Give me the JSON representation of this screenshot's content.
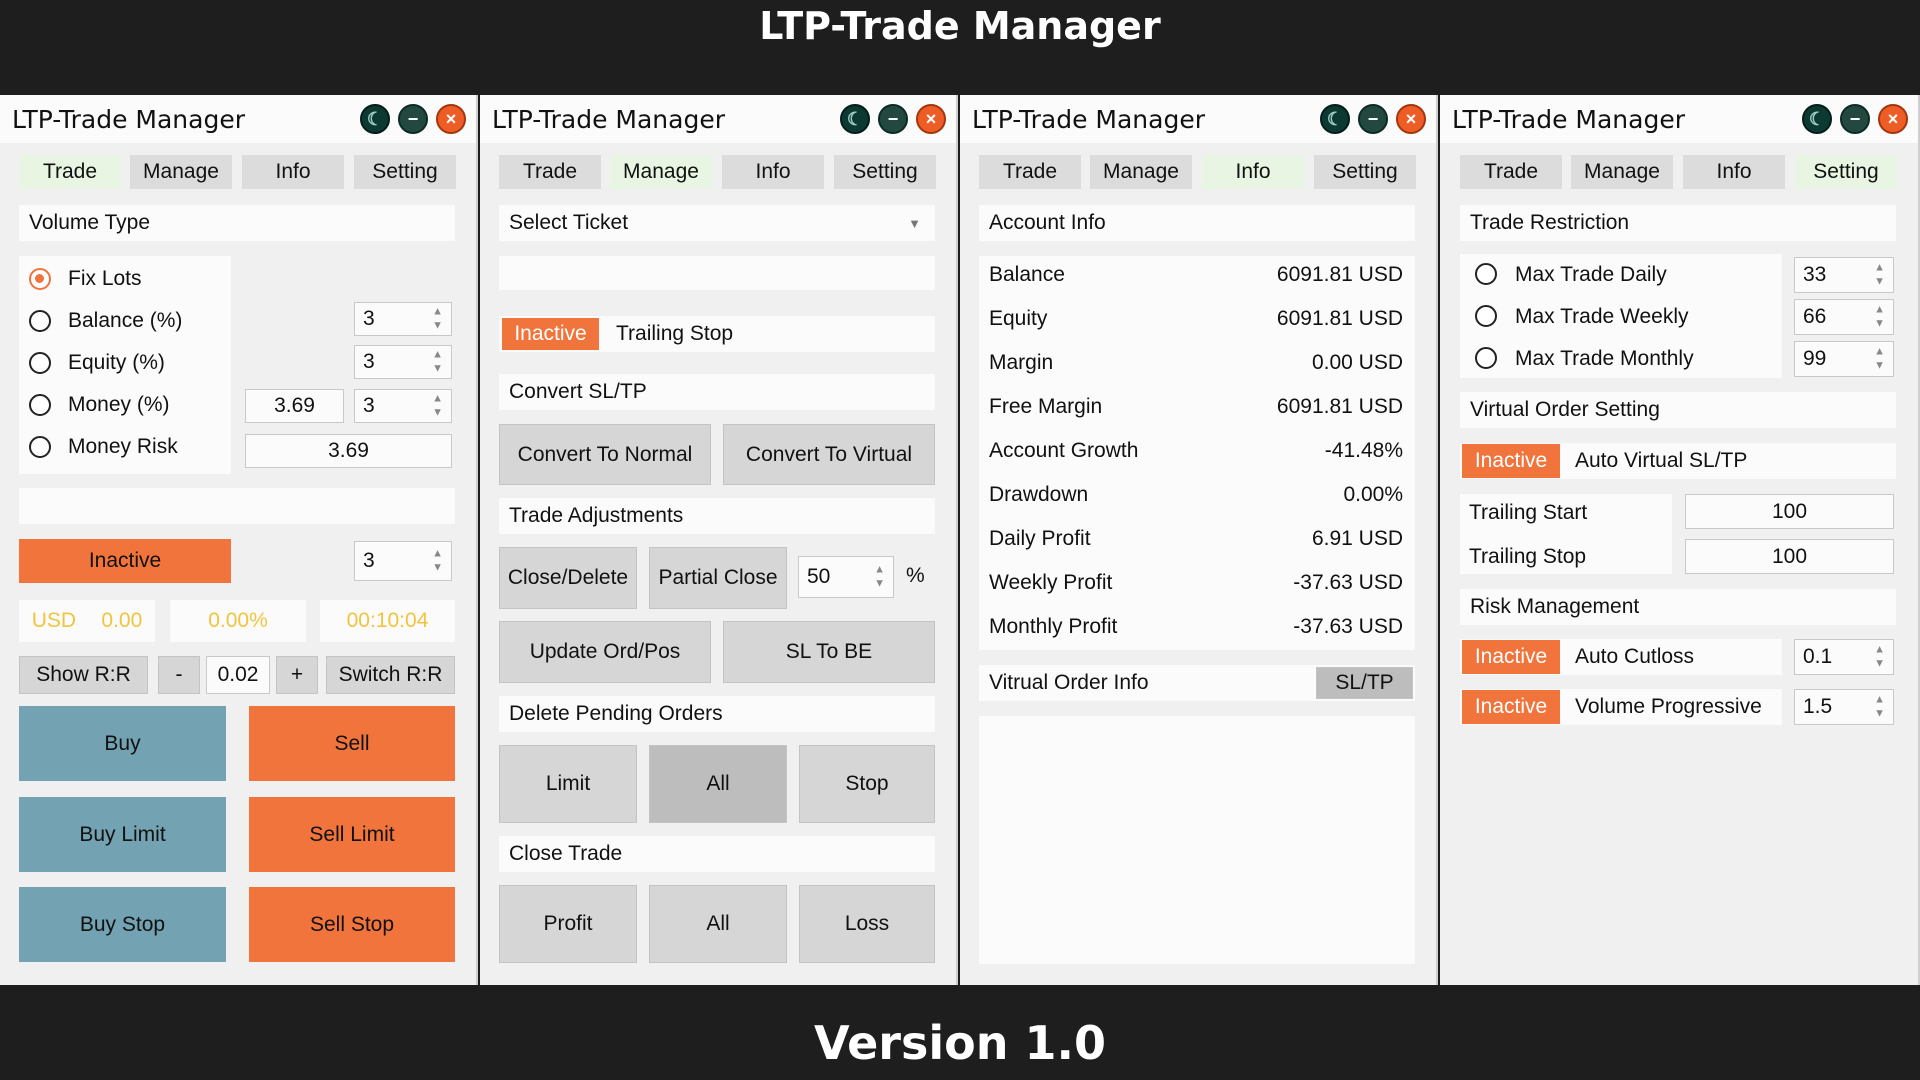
{
  "banner": {
    "title": "LTP-Trade Manager",
    "version": "Version 1.0"
  },
  "window_title": "LTP-Trade Manager",
  "tabs": [
    "Trade",
    "Manage",
    "Info",
    "Setting"
  ],
  "trade": {
    "volume_type_label": "Volume Type",
    "options": [
      "Fix Lots",
      "Balance (%)",
      "Equity (%)",
      "Money (%)",
      "Money Risk"
    ],
    "selected_option": "Fix Lots",
    "balance_pct": "3",
    "equity_pct": "3",
    "money_pct_amount": "3.69",
    "money_pct": "3",
    "money_risk": "3.69",
    "status_button": "Inactive",
    "status_value": "3",
    "currency": "USD",
    "pnl": "0.00",
    "pnl_pct": "0.00%",
    "timer": "00:10:04",
    "show_rr": "Show R:R",
    "minus": "-",
    "rr_step": "0.02",
    "plus": "+",
    "switch_rr": "Switch R:R",
    "buy": "Buy",
    "sell": "Sell",
    "buy_limit": "Buy Limit",
    "sell_limit": "Sell Limit",
    "buy_stop": "Buy Stop",
    "sell_stop": "Sell Stop"
  },
  "manage": {
    "select_ticket": "Select Ticket",
    "trailing_status": "Inactive",
    "trailing_label": "Trailing Stop",
    "convert_label": "Convert SL/TP",
    "convert_normal": "Convert To Normal",
    "convert_virtual": "Convert To Virtual",
    "adjust_label": "Trade Adjustments",
    "close_delete": "Close/Delete",
    "partial_close": "Partial Close",
    "partial_value": "50",
    "percent": "%",
    "update": "Update Ord/Pos",
    "sl_to_be": "SL To BE",
    "delete_label": "Delete Pending Orders",
    "limit": "Limit",
    "all": "All",
    "stop": "Stop",
    "close_label": "Close Trade",
    "profit": "Profit",
    "loss": "Loss"
  },
  "info": {
    "account_label": "Account Info",
    "rows": [
      {
        "label": "Balance",
        "value": "6091.81 USD"
      },
      {
        "label": "Equity",
        "value": "6091.81 USD"
      },
      {
        "label": "Margin",
        "value": "0.00 USD"
      },
      {
        "label": "Free Margin",
        "value": "6091.81 USD"
      },
      {
        "label": "Account Growth",
        "value": "-41.48%"
      },
      {
        "label": "Drawdown",
        "value": "0.00%"
      },
      {
        "label": "Daily Profit",
        "value": "6.91 USD"
      },
      {
        "label": "Weekly Profit",
        "value": "-37.63 USD"
      },
      {
        "label": "Monthly Profit",
        "value": "-37.63 USD"
      }
    ],
    "virtual_label": "Vitrual Order Info",
    "sltp_button": "SL/TP"
  },
  "setting": {
    "restriction_label": "Trade Restriction",
    "max_daily": "Max Trade Daily",
    "max_daily_value": "33",
    "max_weekly": "Max Trade Weekly",
    "max_weekly_value": "66",
    "max_monthly": "Max Trade Monthly",
    "max_monthly_value": "99",
    "virtual_label": "Virtual Order Setting",
    "auto_virtual_status": "Inactive",
    "auto_virtual_label": "Auto Virtual SL/TP",
    "trailing_start": "Trailing Start",
    "trailing_start_value": "100",
    "trailing_stop": "Trailing Stop",
    "trailing_stop_value": "100",
    "risk_label": "Risk Management",
    "cutloss_status": "Inactive",
    "cutloss_label": "Auto Cutloss",
    "cutloss_value": "0.1",
    "progressive_status": "Inactive",
    "progressive_label": "Volume Progressive",
    "progressive_value": "1.5"
  },
  "colors": {
    "accent_orange": "#f0743b",
    "buy_blue": "#73a2b2",
    "active_tab": "#e7f5e2",
    "yellow_text": "#f2c43e"
  },
  "icons": [
    "moon-icon",
    "minimize-icon",
    "close-icon"
  ]
}
